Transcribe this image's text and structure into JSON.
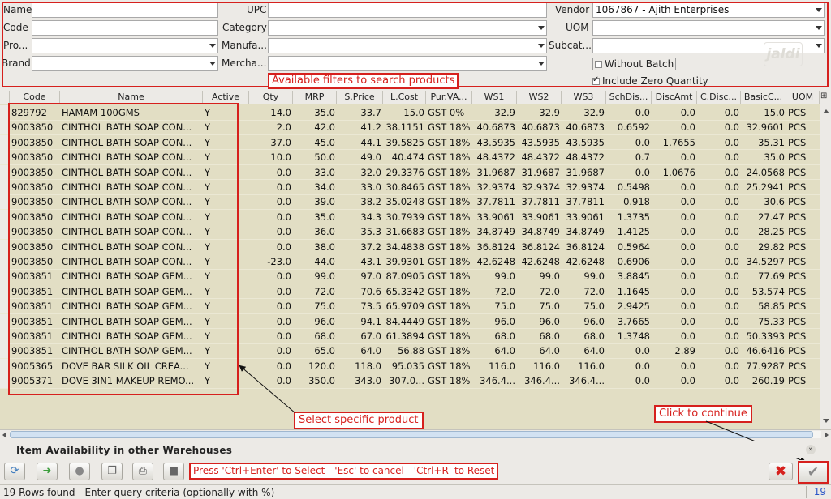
{
  "filters": {
    "name": {
      "label": "Name",
      "value": ""
    },
    "code": {
      "label": "Code",
      "value": ""
    },
    "product": {
      "label": "Pro...",
      "value": ""
    },
    "brand": {
      "label": "Brand",
      "value": ""
    },
    "upc": {
      "label": "UPC",
      "value": ""
    },
    "category": {
      "label": "Category",
      "value": ""
    },
    "manufacturer": {
      "label": "Manufa...",
      "value": ""
    },
    "merchandise": {
      "label": "Mercha...",
      "value": ""
    },
    "vendor": {
      "label": "Vendor",
      "value": "1067867 - Ajith Enterprises"
    },
    "uom": {
      "label": "UOM",
      "value": ""
    },
    "subcategory": {
      "label": "Subcat...",
      "value": ""
    },
    "without_batch": {
      "label": "Without Batch",
      "checked": false
    },
    "include_zero_qty": {
      "label": "Include Zero Quantity",
      "checked": true
    },
    "annotation": "Available filters to search products",
    "logo_text": "jaldi"
  },
  "grid": {
    "columns": [
      "Code",
      "Name",
      "Active",
      "Qty",
      "MRP",
      "S.Price",
      "L.Cost",
      "Pur.VA...",
      "WS1",
      "WS2",
      "WS3",
      "SchDis...",
      "DiscAmt",
      "C.Disc...",
      "BasicC...",
      "UOM"
    ],
    "rows": [
      [
        "829792",
        "HAMAM 100GMS",
        "Y",
        "14.0",
        "35.0",
        "33.7",
        "15.0",
        "GST 0%",
        "32.9",
        "32.9",
        "32.9",
        "0.0",
        "0.0",
        "0.0",
        "15.0",
        "PCS"
      ],
      [
        "9003850",
        "CINTHOL BATH SOAP CON...",
        "Y",
        "2.0",
        "42.0",
        "41.2",
        "38.1151",
        "GST 18%",
        "40.6873",
        "40.6873",
        "40.6873",
        "0.6592",
        "0.0",
        "0.0",
        "32.9601",
        "PCS"
      ],
      [
        "9003850",
        "CINTHOL BATH SOAP CON...",
        "Y",
        "37.0",
        "45.0",
        "44.1",
        "39.5825",
        "GST 18%",
        "43.5935",
        "43.5935",
        "43.5935",
        "0.0",
        "1.7655",
        "0.0",
        "35.31",
        "PCS"
      ],
      [
        "9003850",
        "CINTHOL BATH SOAP CON...",
        "Y",
        "10.0",
        "50.0",
        "49.0",
        "40.474",
        "GST 18%",
        "48.4372",
        "48.4372",
        "48.4372",
        "0.7",
        "0.0",
        "0.0",
        "35.0",
        "PCS"
      ],
      [
        "9003850",
        "CINTHOL BATH SOAP CON...",
        "Y",
        "0.0",
        "33.0",
        "32.0",
        "29.3376",
        "GST 18%",
        "31.9687",
        "31.9687",
        "31.9687",
        "0.0",
        "1.0676",
        "0.0",
        "24.0568",
        "PCS"
      ],
      [
        "9003850",
        "CINTHOL BATH SOAP CON...",
        "Y",
        "0.0",
        "34.0",
        "33.0",
        "30.8465",
        "GST 18%",
        "32.9374",
        "32.9374",
        "32.9374",
        "0.5498",
        "0.0",
        "0.0",
        "25.2941",
        "PCS"
      ],
      [
        "9003850",
        "CINTHOL BATH SOAP CON...",
        "Y",
        "0.0",
        "39.0",
        "38.2",
        "35.0248",
        "GST 18%",
        "37.7811",
        "37.7811",
        "37.7811",
        "0.918",
        "0.0",
        "0.0",
        "30.6",
        "PCS"
      ],
      [
        "9003850",
        "CINTHOL BATH SOAP CON...",
        "Y",
        "0.0",
        "35.0",
        "34.3",
        "30.7939",
        "GST 18%",
        "33.9061",
        "33.9061",
        "33.9061",
        "1.3735",
        "0.0",
        "0.0",
        "27.47",
        "PCS"
      ],
      [
        "9003850",
        "CINTHOL BATH SOAP CON...",
        "Y",
        "0.0",
        "36.0",
        "35.3",
        "31.6683",
        "GST 18%",
        "34.8749",
        "34.8749",
        "34.8749",
        "1.4125",
        "0.0",
        "0.0",
        "28.25",
        "PCS"
      ],
      [
        "9003850",
        "CINTHOL BATH SOAP CON...",
        "Y",
        "0.0",
        "38.0",
        "37.2",
        "34.4838",
        "GST 18%",
        "36.8124",
        "36.8124",
        "36.8124",
        "0.5964",
        "0.0",
        "0.0",
        "29.82",
        "PCS"
      ],
      [
        "9003850",
        "CINTHOL BATH SOAP CON...",
        "Y",
        "-23.0",
        "44.0",
        "43.1",
        "39.9301",
        "GST 18%",
        "42.6248",
        "42.6248",
        "42.6248",
        "0.6906",
        "0.0",
        "0.0",
        "34.5297",
        "PCS"
      ],
      [
        "9003851",
        "CINTHOL BATH SOAP GEM...",
        "Y",
        "0.0",
        "99.0",
        "97.0",
        "87.0905",
        "GST 18%",
        "99.0",
        "99.0",
        "99.0",
        "3.8845",
        "0.0",
        "0.0",
        "77.69",
        "PCS"
      ],
      [
        "9003851",
        "CINTHOL BATH SOAP GEM...",
        "Y",
        "0.0",
        "72.0",
        "70.6",
        "65.3342",
        "GST 18%",
        "72.0",
        "72.0",
        "72.0",
        "1.1645",
        "0.0",
        "0.0",
        "53.574",
        "PCS"
      ],
      [
        "9003851",
        "CINTHOL BATH SOAP GEM...",
        "Y",
        "0.0",
        "75.0",
        "73.5",
        "65.9709",
        "GST 18%",
        "75.0",
        "75.0",
        "75.0",
        "2.9425",
        "0.0",
        "0.0",
        "58.85",
        "PCS"
      ],
      [
        "9003851",
        "CINTHOL BATH SOAP GEM...",
        "Y",
        "0.0",
        "96.0",
        "94.1",
        "84.4449",
        "GST 18%",
        "96.0",
        "96.0",
        "96.0",
        "3.7665",
        "0.0",
        "0.0",
        "75.33",
        "PCS"
      ],
      [
        "9003851",
        "CINTHOL BATH SOAP GEM...",
        "Y",
        "0.0",
        "68.0",
        "67.0",
        "61.3894",
        "GST 18%",
        "68.0",
        "68.0",
        "68.0",
        "1.3748",
        "0.0",
        "0.0",
        "50.3393",
        "PCS"
      ],
      [
        "9003851",
        "CINTHOL BATH SOAP GEM...",
        "Y",
        "0.0",
        "65.0",
        "64.0",
        "56.88",
        "GST 18%",
        "64.0",
        "64.0",
        "64.0",
        "0.0",
        "2.89",
        "0.0",
        "46.6416",
        "PCS"
      ],
      [
        "9005365",
        "DOVE BAR SILK OIL CREA...",
        "Y",
        "0.0",
        "120.0",
        "118.0",
        "95.035",
        "GST 18%",
        "116.0",
        "116.0",
        "116.0",
        "0.0",
        "0.0",
        "0.0",
        "77.9287",
        "PCS"
      ],
      [
        "9005371",
        "DOVE 3IN1 MAKEUP REMO...",
        "Y",
        "0.0",
        "350.0",
        "343.0",
        "307.0...",
        "GST 18%",
        "346.4...",
        "346.4...",
        "346.4...",
        "0.0",
        "0.0",
        "0.0",
        "260.19",
        "PCS"
      ]
    ]
  },
  "annotations": {
    "select_product": "Select specific product",
    "click_continue": "Click to continue"
  },
  "warehouse": {
    "title": "Item Availability in other Warehouses"
  },
  "toolbar": {
    "shortcut_hint": "Press 'Ctrl+Enter' to Select - 'Esc' to cancel - 'Ctrl+R' to Reset",
    "buttons": [
      "refresh-icon",
      "arrow-icon",
      "circle-icon",
      "copy-icon",
      "print-icon",
      "stop-icon"
    ]
  },
  "status": {
    "text": "19 Rows found - Enter query criteria (optionally with %)",
    "count": "19"
  },
  "colors": {
    "annotation_red": "#d6201d",
    "grid_bg": "#e2dec4",
    "count_blue": "#2a56c8"
  }
}
